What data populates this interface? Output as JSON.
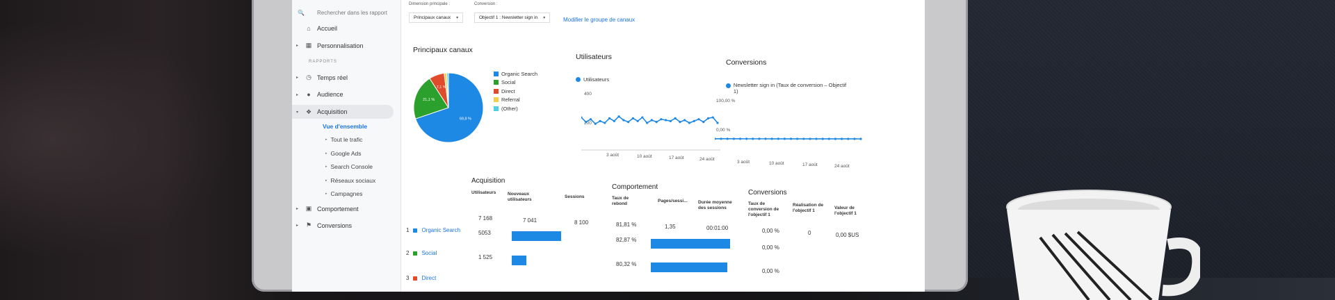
{
  "sidebar": {
    "search_placeholder": "Rechercher dans les rapport",
    "home": "Accueil",
    "customization": "Personnalisation",
    "reports_section": "RAPPORTS",
    "realtime": "Temps réel",
    "audience": "Audience",
    "acquisition": "Acquisition",
    "overview": "Vue d'ensemble",
    "all_traffic": "Tout le trafic",
    "google_ads": "Google Ads",
    "search_console": "Search Console",
    "social_networks": "Réseaux sociaux",
    "campaigns": "Campagnes",
    "behavior": "Comportement",
    "conversions": "Conversions"
  },
  "controls": {
    "primary_dimension_label": "Dimension principale :",
    "primary_dimension_value": "Principaux canaux",
    "conversion_label": "Conversion :",
    "conversion_value": "Objectif 1 : Newsletter sign in",
    "modify_link": "Modifier le groupe de canaux"
  },
  "top_channels": {
    "title": "Principaux canaux",
    "legend": [
      {
        "label": "Organic Search",
        "color": "#1e88e5"
      },
      {
        "label": "Social",
        "color": "#2ca02c"
      },
      {
        "label": "Direct",
        "color": "#e04b2c"
      },
      {
        "label": "Referral",
        "color": "#f2d04b"
      },
      {
        "label": "(Other)",
        "color": "#4dd0e1"
      }
    ],
    "labels": [
      "69,8 %",
      "21,1 %",
      "7,1 %"
    ]
  },
  "users": {
    "title": "Utilisateurs",
    "legend": "Utilisateurs",
    "y_ticks": [
      "400",
      "200"
    ],
    "x_ticks": [
      "3 août",
      "10 août",
      "17 août",
      "24 août"
    ]
  },
  "conversions_chart": {
    "title": "Conversions",
    "legend": "Newsletter sign in (Taux de conversion – Objectif 1)",
    "y_ticks": [
      "100,00 %",
      "0,00 %"
    ],
    "x_ticks": [
      "3 août",
      "10 août",
      "17 août",
      "24 août"
    ]
  },
  "chart_data": [
    {
      "type": "pie",
      "title": "Principaux canaux",
      "categories": [
        "Organic Search",
        "Social",
        "Direct",
        "Referral",
        "(Other)"
      ],
      "values": [
        69.8,
        21.1,
        7.1,
        1.2,
        0.8
      ]
    },
    {
      "type": "line",
      "title": "Utilisateurs",
      "series": [
        {
          "name": "Utilisateurs",
          "values": [
            280,
            230,
            260,
            210,
            240,
            220,
            270,
            240,
            290,
            250,
            230,
            270,
            240,
            280,
            220,
            250,
            230,
            260,
            250,
            240,
            270,
            230,
            250,
            220,
            240,
            260,
            230,
            270,
            280,
            220
          ]
        }
      ],
      "ylim": [
        0,
        500
      ]
    },
    {
      "type": "line",
      "title": "Conversions",
      "series": [
        {
          "name": "Newsletter sign in (Taux de conversion – Objectif 1)",
          "values": [
            0.6,
            0.55,
            0.55,
            0.5,
            0.5,
            0.45,
            0.45,
            0.4,
            0.4,
            0.35,
            0.35,
            0.3,
            0.3,
            0.25,
            0.25,
            0.2,
            0.2,
            0.15,
            0.15,
            0.1,
            0.1,
            0.05,
            0.05,
            0.0
          ]
        }
      ],
      "ylim": [
        0,
        100
      ]
    }
  ],
  "table": {
    "acquisition_title": "Acquisition",
    "behavior_title": "Comportement",
    "conversions_title": "Conversions",
    "headers": {
      "users": "Utilisateurs",
      "new_users": "Nouveaux utilisateurs",
      "sessions": "Sessions",
      "bounce_rate": "Taux de rebond",
      "pages_per_session": "Pages/sessi...",
      "avg_duration": "Durée moyenne des sessions",
      "conversion_rate": "Taux de conversion de l'objectif 1",
      "goal_completions": "Réalisation de l'objectif 1",
      "goal_value": "Valeur de l'objectif 1"
    },
    "totals": {
      "users": "7 168",
      "new_users": "7 041",
      "sessions": "8 100",
      "bounce": "81,81 %",
      "pages": "1,35",
      "duration": "00:01:00",
      "conv_rate": "0,00 %",
      "completions": "0",
      "value": "0,00 $US"
    },
    "rows": [
      {
        "num": "1",
        "name": "Organic Search",
        "color": "#1e88e5",
        "users": "5053",
        "bounce": "82,87 %",
        "conv_rate": "0,00 %",
        "users_share": 0.705,
        "pages_share": 0.95
      },
      {
        "num": "2",
        "name": "Social",
        "color": "#2ca02c",
        "users": "1 525",
        "bounce": "80,32 %",
        "conv_rate": "0,00 %",
        "users_share": 0.213,
        "pages_share": 0.92
      },
      {
        "num": "3",
        "name": "Direct",
        "color": "#e04b2c",
        "users": "",
        "bounce": "",
        "conv_rate": "",
        "users_share": 0.0,
        "pages_share": 0.0
      }
    ]
  }
}
